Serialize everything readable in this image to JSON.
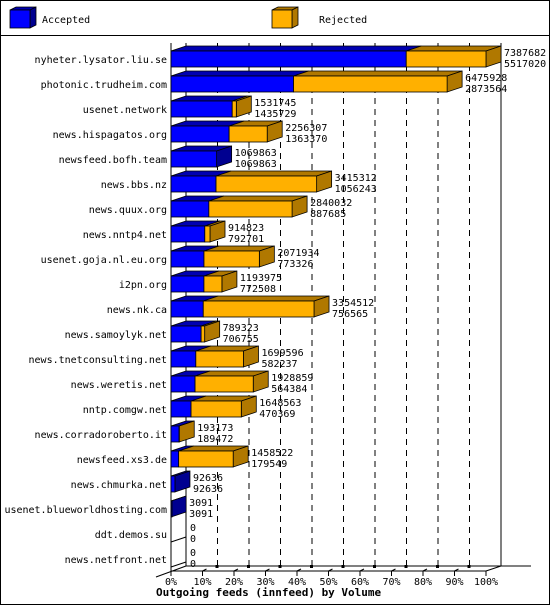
{
  "chart_data": {
    "type": "bar",
    "orientation": "horizontal",
    "stacked": true,
    "style": "3d",
    "title": "Outgoing feeds (innfeed) by Volume",
    "xlabel": "",
    "ylabel": "",
    "xlim": [
      0,
      100
    ],
    "x_unit": "%",
    "x_ticks": [
      "0%",
      "10%",
      "20%",
      "30%",
      "40%",
      "50%",
      "60%",
      "70%",
      "80%",
      "90%",
      "100%"
    ],
    "grid": true,
    "legend_position": "top",
    "legend": [
      {
        "name": "Accepted",
        "color": "#0000ff"
      },
      {
        "name": "Rejected",
        "color": "#ffb000"
      }
    ],
    "categories": [
      "nyheter.lysator.liu.se",
      "photonic.trudheim.com",
      "usenet.network",
      "news.hispagatos.org",
      "newsfeed.bofh.team",
      "news.bbs.nz",
      "news.quux.org",
      "news.nntp4.net",
      "usenet.goja.nl.eu.org",
      "i2pn.org",
      "news.nk.ca",
      "news.samoylyk.net",
      "news.tnetconsulting.net",
      "news.weretis.net",
      "nntp.comgw.net",
      "news.corradoroberto.it",
      "newsfeed.xs3.de",
      "news.chmurka.net",
      "usenet.blueworldhosting.com",
      "ddt.demos.su",
      "news.netfront.net"
    ],
    "totals": [
      7387682,
      6475928,
      1531745,
      2256307,
      1069863,
      3415312,
      2840032,
      914823,
      2071934,
      1193975,
      3354512,
      789323,
      1699596,
      1928859,
      1648563,
      193173,
      1458522,
      92636,
      3091,
      0,
      0
    ],
    "series": [
      {
        "name": "Accepted",
        "values": [
          5517020,
          2873564,
          1435729,
          1363370,
          1069863,
          1056243,
          887685,
          792701,
          773326,
          772508,
          756565,
          706755,
          582237,
          564384,
          470369,
          189472,
          179549,
          92636,
          3091,
          0,
          0
        ]
      },
      {
        "name": "Rejected",
        "values": [
          1870662,
          3602364,
          96016,
          892937,
          0,
          2359069,
          1952347,
          122122,
          1298608,
          421467,
          2597947,
          82568,
          1117359,
          1364475,
          1178194,
          3701,
          1278973,
          0,
          0,
          0,
          0
        ]
      }
    ]
  }
}
